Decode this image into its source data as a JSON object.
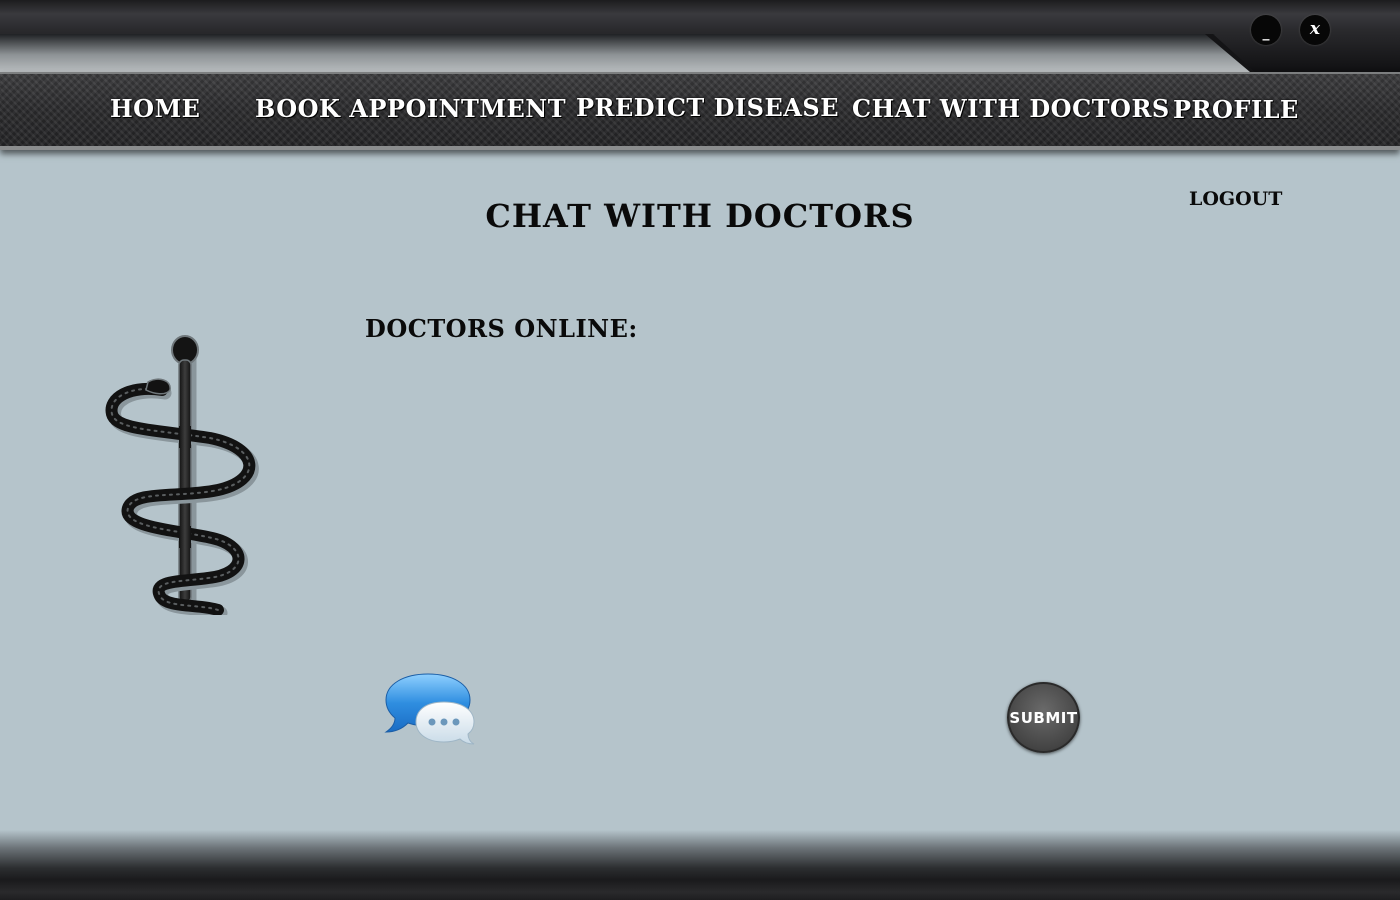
{
  "window": {
    "minimize_label": "_",
    "close_label": "x"
  },
  "nav": {
    "items": [
      {
        "label": "HOME"
      },
      {
        "label": "BOOK APPOINTMENT"
      },
      {
        "label": "PREDICT DISEASE"
      },
      {
        "label": "CHAT WITH DOCTORS"
      },
      {
        "label": "PROFILE"
      }
    ]
  },
  "page": {
    "title": "CHAT WITH DOCTORS",
    "logout_label": "LOGOUT",
    "doctors_online_label": "DOCTORS ONLINE:",
    "doctors_online": []
  },
  "actions": {
    "submit_label": "SUBMIT"
  },
  "icons": {
    "logo": "caduceus-icon",
    "chat": "chat-bubbles-icon"
  },
  "colors": {
    "background": "#b5c4cb",
    "nav_text": "#ffffff",
    "text": "#0a0a0a",
    "chat_blue": "#2f8ee0",
    "submit_button": "#4a4a4a"
  }
}
